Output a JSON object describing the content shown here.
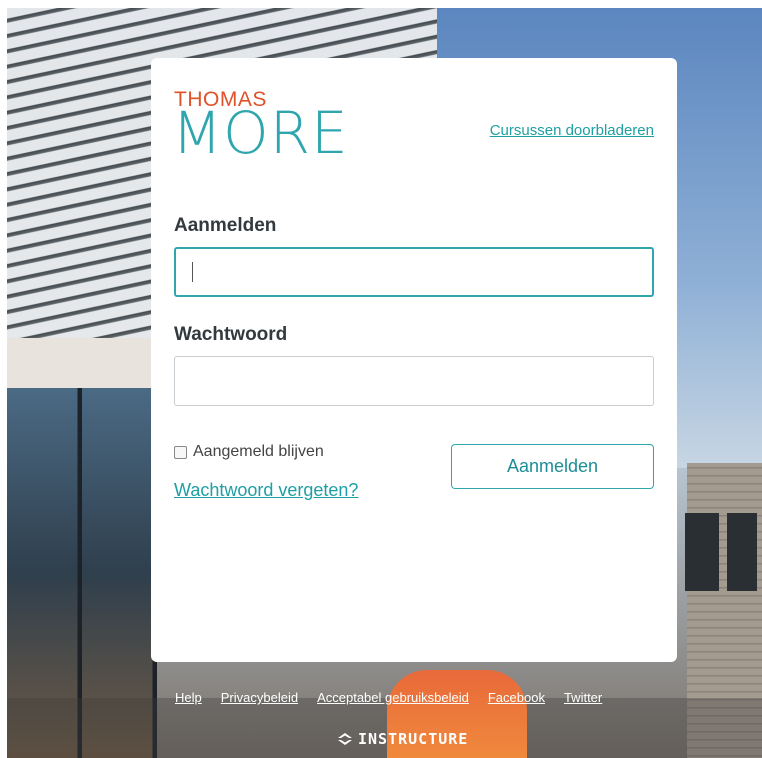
{
  "logo": {
    "line1": "THOMAS",
    "line2": "MORE"
  },
  "browse_link": "Cursussen doorbladeren",
  "login": {
    "username_label": "Aanmelden",
    "username_value": "",
    "password_label": "Wachtwoord",
    "password_value": "",
    "remember_label": "Aangemeld blijven",
    "remember_checked": false,
    "forgot_link": "Wachtwoord vergeten?",
    "submit_label": "Aanmelden"
  },
  "footer": {
    "links": [
      "Help",
      "Privacybeleid",
      "Acceptabel gebruiksbeleid",
      "Facebook",
      "Twitter"
    ],
    "brand": "INSTRUCTURE"
  },
  "colors": {
    "logo_orange": "#e0522a",
    "accent_teal": "#2fa6ae",
    "link_teal": "#1d9fa3"
  }
}
